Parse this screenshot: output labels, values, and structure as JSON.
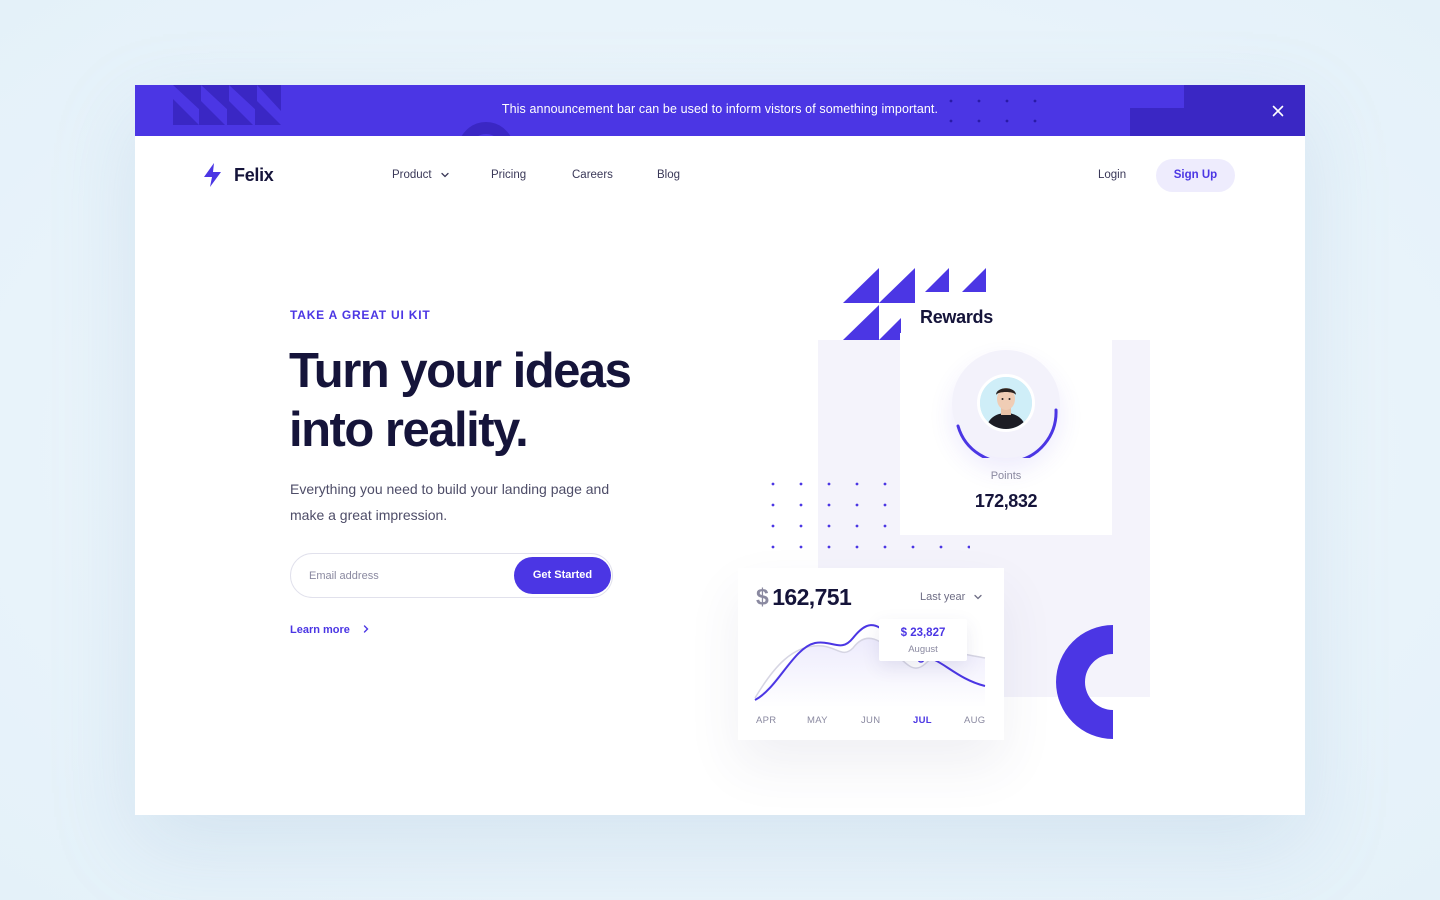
{
  "announcement": {
    "text": "This announcement bar can be used to inform vistors of something important.",
    "close_icon": "close-icon"
  },
  "brand": {
    "name": "Felix",
    "logo_icon": "lightning-bolt-icon",
    "accent": "#4b36e4"
  },
  "nav": {
    "items": [
      {
        "label": "Product",
        "has_dropdown": true
      },
      {
        "label": "Pricing"
      },
      {
        "label": "Careers"
      },
      {
        "label": "Blog"
      }
    ],
    "login": "Login",
    "signup": "Sign Up"
  },
  "hero": {
    "eyebrow": "TAKE A GREAT UI KIT",
    "headline_line1": "Turn your ideas",
    "headline_line2": "into reality.",
    "subtext": "Everything you need to build your landing page and make a great impression.",
    "email_placeholder": "Email address",
    "cta": "Get Started",
    "learn_more": "Learn more"
  },
  "rewards": {
    "title": "Rewards",
    "points_label": "Points",
    "points_value": "172,832"
  },
  "stats": {
    "currency": "$",
    "value": "162,751",
    "period": "Last year",
    "tooltip_value": "$ 23,827",
    "tooltip_label": "August",
    "months": [
      "APR",
      "MAY",
      "JUN",
      "JUL",
      "AUG"
    ],
    "active_month": "JUL"
  },
  "colors": {
    "primary": "#4b36e4",
    "primary_dark": "#3a27c4",
    "text_dark": "#15143a",
    "muted": "#8a89a0",
    "page_bg": "#eaf4fb"
  }
}
